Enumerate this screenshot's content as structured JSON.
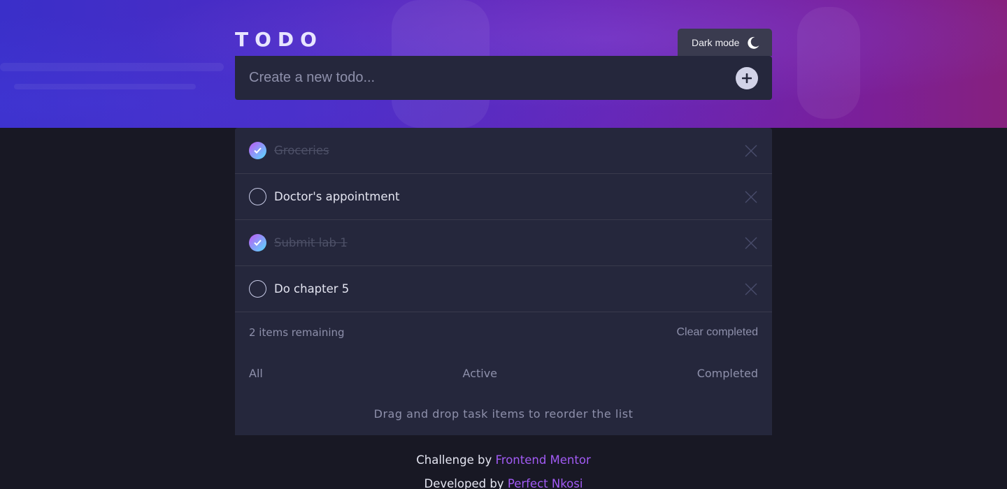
{
  "header": {
    "title": "TODO",
    "mode_label": "Dark mode"
  },
  "new_todo": {
    "placeholder": "Create a new todo...",
    "value": ""
  },
  "todos": [
    {
      "text": "Groceries",
      "completed": true
    },
    {
      "text": "Doctor's appointment",
      "completed": false
    },
    {
      "text": "Submit lab 1",
      "completed": true
    },
    {
      "text": "Do chapter 5",
      "completed": false
    }
  ],
  "summary": {
    "remaining": "2 items remaining",
    "clear_label": "Clear completed"
  },
  "filters": {
    "all": "All",
    "active": "Active",
    "completed": "Completed"
  },
  "hint": "Drag and drop task items to reorder the list",
  "credits": {
    "challenge_prefix": "Challenge by",
    "challenge_link": "Frontend Mentor",
    "developer_prefix": "Developed by",
    "developer_link": "Perfect Nkosi"
  },
  "icons": {
    "mode": "moon-icon",
    "add": "plus-icon",
    "check": "check-icon",
    "delete": "close-icon"
  },
  "colors": {
    "background": "#181824",
    "card": "#25273c",
    "check_gradient_start": "#c058f3",
    "check_gradient_end": "#55ddff",
    "link": "#a25bf5"
  }
}
